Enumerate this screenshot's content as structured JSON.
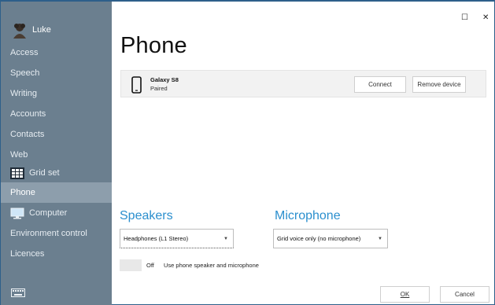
{
  "window": {
    "maximize_icon": "☐",
    "close_icon": "✕"
  },
  "sidebar": {
    "user_name": "Luke",
    "items": [
      {
        "label": "Access"
      },
      {
        "label": "Speech"
      },
      {
        "label": "Writing"
      },
      {
        "label": "Accounts"
      },
      {
        "label": "Contacts"
      },
      {
        "label": "Web"
      },
      {
        "label": "Grid set"
      },
      {
        "label": "Phone"
      },
      {
        "label": "Computer"
      },
      {
        "label": "Environment control"
      },
      {
        "label": "Licences"
      }
    ],
    "active": "Phone"
  },
  "main": {
    "title": "Phone",
    "device": {
      "name": "Galaxy S8",
      "status": "Paired",
      "connect_label": "Connect",
      "remove_label": "Remove device"
    },
    "speakers": {
      "heading": "Speakers",
      "selected": "Headphones (L1 Stereo)"
    },
    "microphone": {
      "heading": "Microphone",
      "selected": "Grid voice only (no microphone)"
    },
    "phone_toggle": {
      "state": "Off",
      "label": "Use phone speaker and microphone"
    },
    "ok_label": "OK",
    "cancel_label": "Cancel"
  },
  "colors": {
    "sidebar": "#6b7f8f",
    "sidebar_active": "#8d9eac",
    "accent": "#2b8fce"
  }
}
